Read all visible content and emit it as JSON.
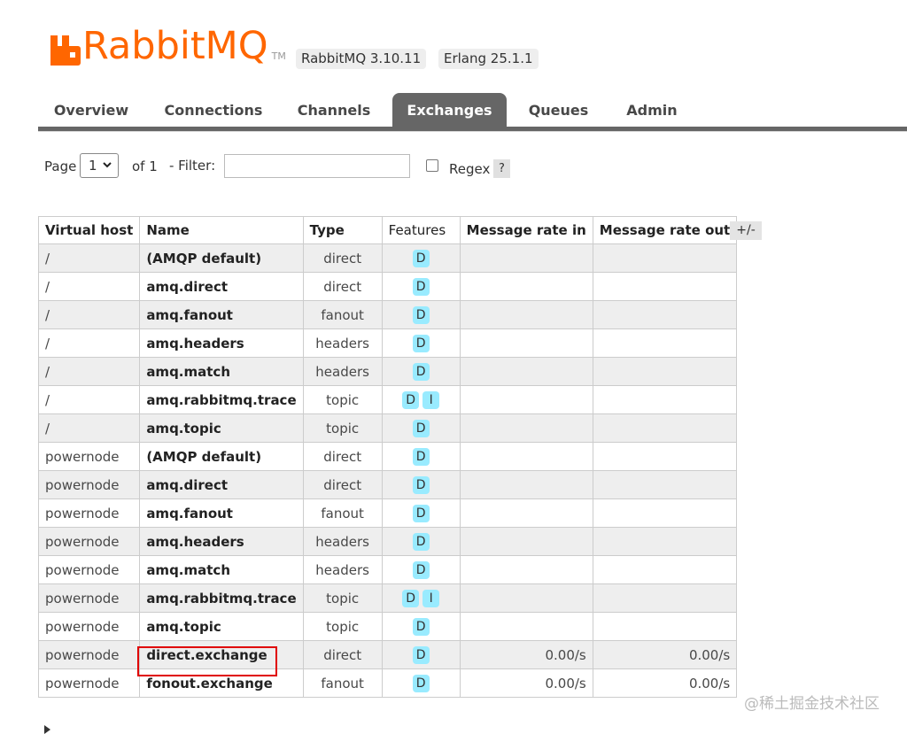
{
  "brand": {
    "name": "RabbitMQ",
    "tm": "TM",
    "color": "#ff6600"
  },
  "versions": {
    "rabbitmq": "RabbitMQ 3.10.11",
    "erlang": "Erlang 25.1.1"
  },
  "tabs": [
    {
      "label": "Overview"
    },
    {
      "label": "Connections"
    },
    {
      "label": "Channels"
    },
    {
      "label": "Exchanges",
      "active": true
    },
    {
      "label": "Queues"
    },
    {
      "label": "Admin"
    }
  ],
  "pager": {
    "page_label": "Page",
    "page_value": "1",
    "of_label": "of 1",
    "filter_label": "- Filter:",
    "filter_value": "",
    "regex_label": "Regex",
    "regex_checked": false,
    "help": "?"
  },
  "table": {
    "columns": [
      "Virtual host",
      "Name",
      "Type",
      "Features",
      "Message rate in",
      "Message rate out"
    ],
    "toggle_columns": "+/-",
    "rows": [
      {
        "vhost": "/",
        "name": "(AMQP default)",
        "type": "direct",
        "features": [
          "D"
        ],
        "rate_in": "",
        "rate_out": ""
      },
      {
        "vhost": "/",
        "name": "amq.direct",
        "type": "direct",
        "features": [
          "D"
        ],
        "rate_in": "",
        "rate_out": ""
      },
      {
        "vhost": "/",
        "name": "amq.fanout",
        "type": "fanout",
        "features": [
          "D"
        ],
        "rate_in": "",
        "rate_out": ""
      },
      {
        "vhost": "/",
        "name": "amq.headers",
        "type": "headers",
        "features": [
          "D"
        ],
        "rate_in": "",
        "rate_out": ""
      },
      {
        "vhost": "/",
        "name": "amq.match",
        "type": "headers",
        "features": [
          "D"
        ],
        "rate_in": "",
        "rate_out": ""
      },
      {
        "vhost": "/",
        "name": "amq.rabbitmq.trace",
        "type": "topic",
        "features": [
          "D",
          "I"
        ],
        "rate_in": "",
        "rate_out": ""
      },
      {
        "vhost": "/",
        "name": "amq.topic",
        "type": "topic",
        "features": [
          "D"
        ],
        "rate_in": "",
        "rate_out": ""
      },
      {
        "vhost": "powernode",
        "name": "(AMQP default)",
        "type": "direct",
        "features": [
          "D"
        ],
        "rate_in": "",
        "rate_out": ""
      },
      {
        "vhost": "powernode",
        "name": "amq.direct",
        "type": "direct",
        "features": [
          "D"
        ],
        "rate_in": "",
        "rate_out": ""
      },
      {
        "vhost": "powernode",
        "name": "amq.fanout",
        "type": "fanout",
        "features": [
          "D"
        ],
        "rate_in": "",
        "rate_out": ""
      },
      {
        "vhost": "powernode",
        "name": "amq.headers",
        "type": "headers",
        "features": [
          "D"
        ],
        "rate_in": "",
        "rate_out": ""
      },
      {
        "vhost": "powernode",
        "name": "amq.match",
        "type": "headers",
        "features": [
          "D"
        ],
        "rate_in": "",
        "rate_out": ""
      },
      {
        "vhost": "powernode",
        "name": "amq.rabbitmq.trace",
        "type": "topic",
        "features": [
          "D",
          "I"
        ],
        "rate_in": "",
        "rate_out": ""
      },
      {
        "vhost": "powernode",
        "name": "amq.topic",
        "type": "topic",
        "features": [
          "D"
        ],
        "rate_in": "",
        "rate_out": ""
      },
      {
        "vhost": "powernode",
        "name": "direct.exchange",
        "type": "direct",
        "features": [
          "D"
        ],
        "rate_in": "0.00/s",
        "rate_out": "0.00/s",
        "highlighted": true
      },
      {
        "vhost": "powernode",
        "name": "fonout.exchange",
        "type": "fanout",
        "features": [
          "D"
        ],
        "rate_in": "0.00/s",
        "rate_out": "0.00/s"
      }
    ]
  },
  "watermark": "@稀土掘金技术社区",
  "colors": {
    "tab_active": "#666666",
    "row_alt": "#eeeeee",
    "feature_badge": "#99ebff",
    "highlight_box": "#e00000"
  }
}
